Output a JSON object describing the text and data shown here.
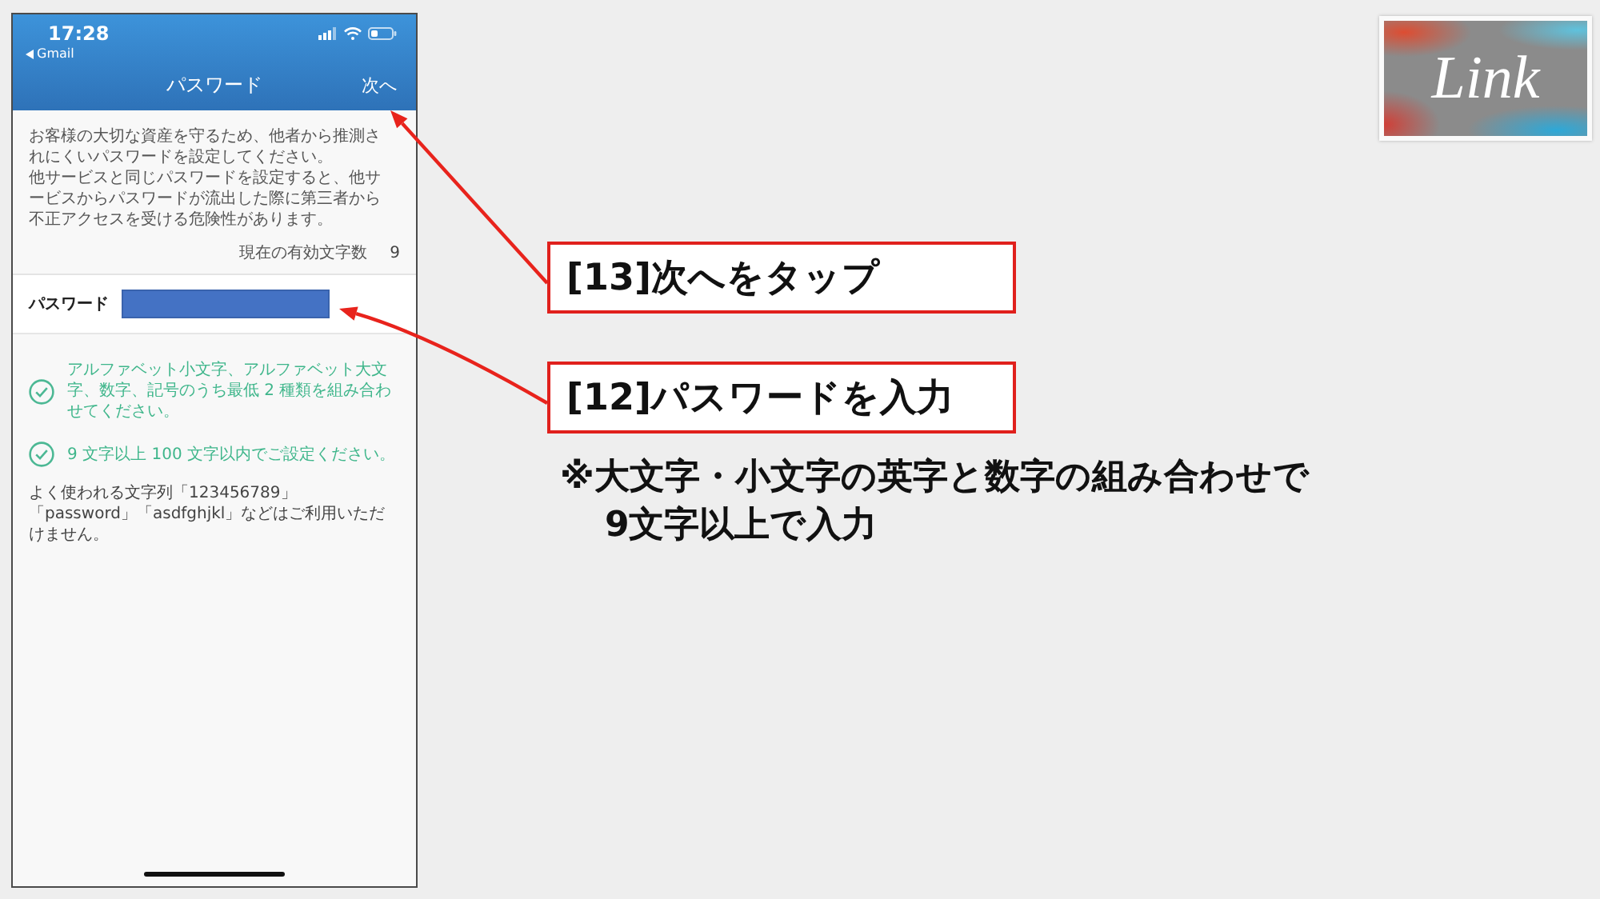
{
  "phone": {
    "status_bar": {
      "time": "17:28",
      "back_label": "Gmail"
    },
    "nav": {
      "title": "パスワード",
      "next": "次へ"
    },
    "description": [
      "お客様の大切な資産を守るため、他者から推測されにくいパスワードを設定してください。",
      "他サービスと同じパスワードを設定すると、他サービスからパスワードが流出した際に第三者から不正アクセスを受ける危険性があります。"
    ],
    "char_count": {
      "label": "現在の有効文字数",
      "value": "9"
    },
    "password": {
      "label": "パスワード"
    },
    "rules": [
      {
        "text": "アルファベット小文字、アルファベット大文字、数字、記号のうち最低 2 種類を組み合わせてください。",
        "met": true
      },
      {
        "text": "9 文字以上 100 文字以内でご設定ください。",
        "met": true
      }
    ],
    "notice": "よく使われる文字列「123456789」「password」「asdfghjkl」などはご利用いただけません。"
  },
  "logo": {
    "text": "Link"
  },
  "callouts": [
    {
      "text": "[13]次へをタップ"
    },
    {
      "text": "[12]パスワードを入力"
    }
  ],
  "note": "※大文字・小文字の英字と数字の組み合わせで\n9文字以上で入力"
}
